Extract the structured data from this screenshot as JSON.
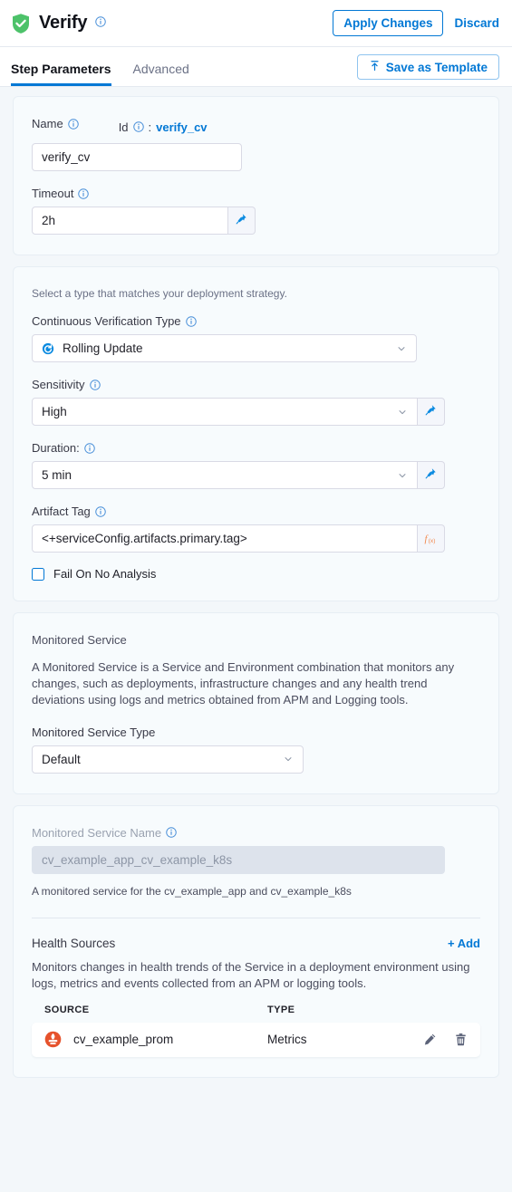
{
  "header": {
    "title": "Verify",
    "title_info_icon": "info-icon",
    "shield_icon": "verify-shield-icon",
    "apply_changes_label": "Apply Changes",
    "discard_label": "Discard"
  },
  "tabs": {
    "items": [
      {
        "label": "Step Parameters",
        "active": true
      },
      {
        "label": "Advanced",
        "active": false
      }
    ],
    "save_template_label": "Save as Template",
    "save_template_icon": "save-template-upload-icon"
  },
  "name_card": {
    "name_label": "Name",
    "id_label": "Id",
    "id_separator": ":",
    "id_value": "verify_cv",
    "name_value": "verify_cv",
    "timeout_label": "Timeout",
    "timeout_value": "2h",
    "pin_icon": "pin-icon"
  },
  "cv_card": {
    "helper": "Select a type that matches your deployment strategy.",
    "type_label": "Continuous Verification Type",
    "type_value": "Rolling Update",
    "type_icon": "rolling-update-icon",
    "sensitivity_label": "Sensitivity",
    "sensitivity_value": "High",
    "duration_label": "Duration:",
    "duration_value": "5 min",
    "artifact_label": "Artifact Tag",
    "artifact_value": "<+serviceConfig.artifacts.primary.tag>",
    "fx_icon": "fx-expression-icon",
    "fx_label": "f(x)",
    "fail_checkbox_label": "Fail On No Analysis",
    "fail_checkbox_checked": false,
    "pin_icon": "pin-icon"
  },
  "monitored_service_card": {
    "section_label": "Monitored Service",
    "description": "A Monitored Service is a Service and Environment combination that monitors any changes, such as deployments, infrastructure changes and any health trend deviations using logs and metrics obtained from APM and Logging tools.",
    "type_label": "Monitored Service Type",
    "type_value": "Default"
  },
  "service_name_card": {
    "name_label": "Monitored Service Name",
    "name_value": "cv_example_app_cv_example_k8s",
    "name_description": "A monitored service for the cv_example_app and cv_example_k8s",
    "health_sources_title": "Health Sources",
    "add_label": "+ Add",
    "health_sources_description": "Monitors changes in health trends of the Service in a deployment environment using logs, metrics and events collected from an APM or logging tools.",
    "table": {
      "columns": [
        "SOURCE",
        "TYPE"
      ],
      "rows": [
        {
          "source": "cv_example_prom",
          "source_icon": "prometheus-icon",
          "type": "Metrics",
          "edit_icon": "pencil-icon",
          "delete_icon": "trash-icon"
        }
      ]
    }
  },
  "colors": {
    "accent_blue": "#0278d5",
    "shield_green": "#4dc26a",
    "prometheus_red": "#e6522c",
    "fx_orange": "#f2874b",
    "page_bg": "#f3f7fa",
    "card_bg": "#f7fbfd"
  }
}
